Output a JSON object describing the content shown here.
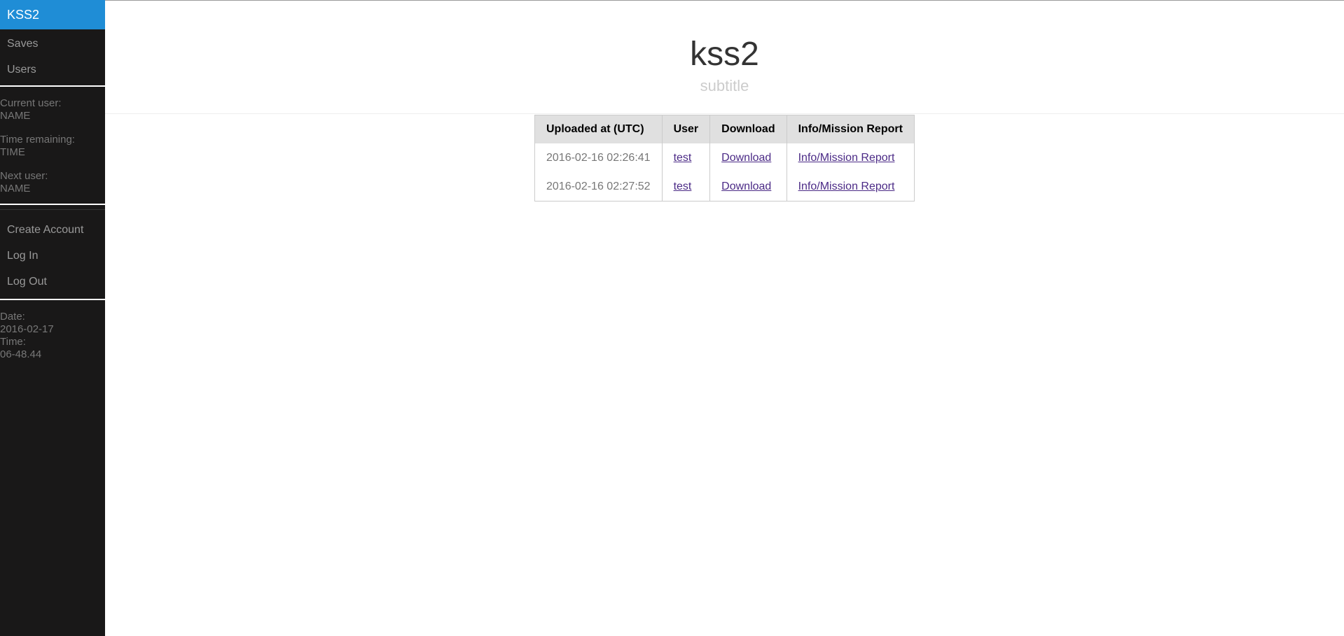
{
  "sidebar": {
    "brand": "KSS2",
    "nav": [
      {
        "label": "Saves"
      },
      {
        "label": "Users"
      }
    ],
    "status": {
      "current_user_label": "Current user:",
      "current_user_value": "NAME",
      "time_remaining_label": "Time remaining:",
      "time_remaining_value": "TIME",
      "next_user_label": "Next user:",
      "next_user_value": "NAME"
    },
    "auth": [
      {
        "label": "Create Account"
      },
      {
        "label": "Log In"
      },
      {
        "label": "Log Out"
      }
    ],
    "datetime": {
      "date_label": "Date:",
      "date_value": "2016-02-17",
      "time_label": "Time:",
      "time_value": "06-48.44"
    }
  },
  "header": {
    "title": "kss2",
    "subtitle": "subtitle"
  },
  "table": {
    "columns": [
      "Uploaded at (UTC)",
      "User",
      "Download",
      "Info/Mission Report"
    ],
    "rows": [
      {
        "uploaded": "2016-02-16 02:26:41",
        "user": "test",
        "download": "Download",
        "report": "Info/Mission Report"
      },
      {
        "uploaded": "2016-02-16 02:27:52",
        "user": "test",
        "download": "Download",
        "report": "Info/Mission Report"
      }
    ]
  },
  "colors": {
    "sidebar_bg": "#191818",
    "brand_bg": "#1f8dd6",
    "link": "#4b2a86",
    "table_header_bg": "#e0e0e0"
  }
}
